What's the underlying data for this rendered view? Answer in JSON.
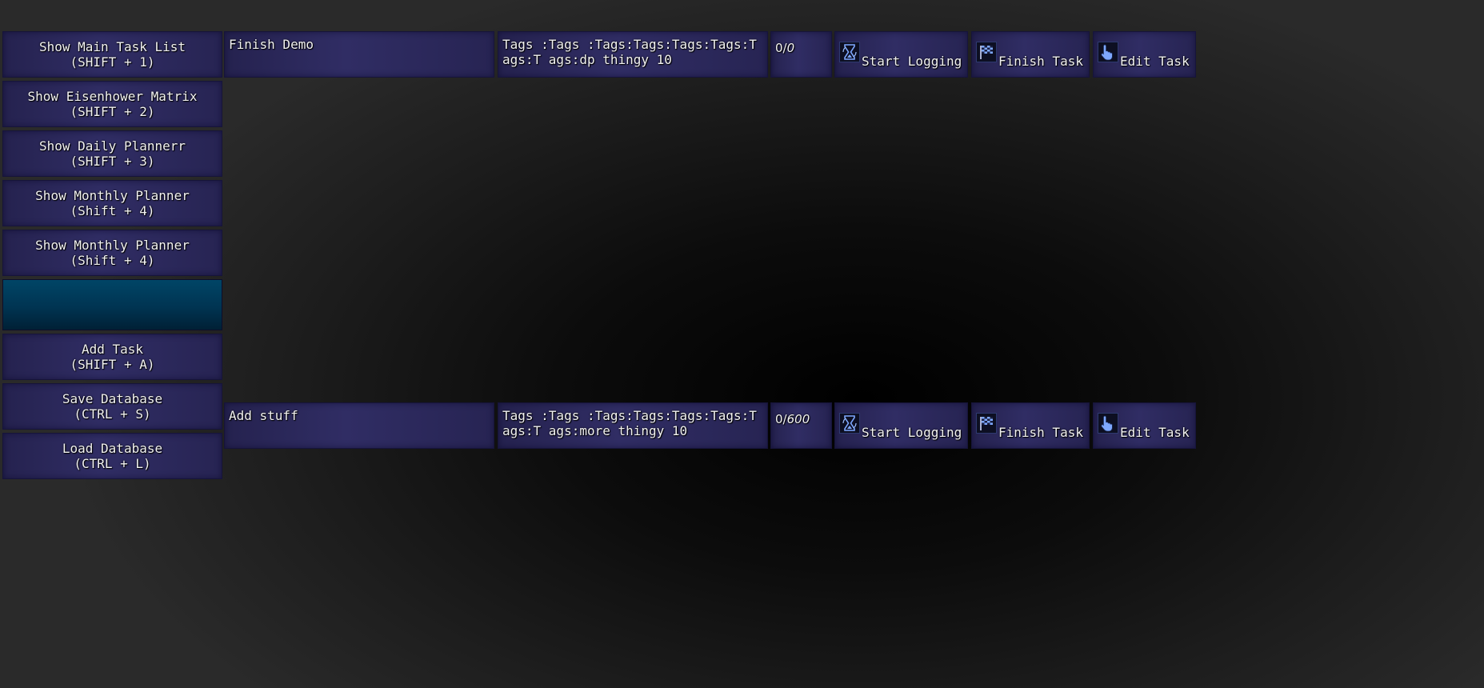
{
  "sidebar": {
    "items": [
      {
        "label": "Show Main Task List",
        "shortcut": "(SHIFT + 1)"
      },
      {
        "label": "Show Eisenhower Matrix",
        "shortcut": "(SHIFT + 2)"
      },
      {
        "label": "Show Daily Plannerr",
        "shortcut": "(SHIFT + 3)"
      },
      {
        "label": "Show Monthly Planner",
        "shortcut": "(Shift + 4)"
      },
      {
        "label": "Show Monthly Planner",
        "shortcut": "(Shift + 4)"
      },
      {
        "label": "Add Task",
        "shortcut": "(SHIFT + A)"
      },
      {
        "label": "Save Database",
        "shortcut": "(CTRL + S)"
      },
      {
        "label": "Load Database",
        "shortcut": "(CTRL + L)"
      }
    ]
  },
  "tasks": [
    {
      "name": "Finish Demo",
      "tags": "Tags :Tags :Tags:Tags:Tags:Tags:Tags:T ags:dp thingy 10",
      "time_logged": "0/",
      "time_total": "0",
      "start_logging_label": "Start Logging",
      "finish_task_label": "Finish Task",
      "edit_task_label": "Edit Task"
    },
    {
      "name": "Add stuff",
      "tags": "Tags :Tags :Tags:Tags:Tags:Tags:Tags:T ags:more thingy 10",
      "time_logged": "0/",
      "time_total": "600",
      "start_logging_label": "Start Logging",
      "finish_task_label": "Finish Task",
      "edit_task_label": "Edit Task"
    }
  ],
  "icons": {
    "start_logging": "hourglass-icon",
    "finish_task": "checkered-flag-icon",
    "edit_task": "pointing-hand-icon"
  },
  "colors": {
    "panel": "#2c2960",
    "panel_border": "#16143a",
    "spacer": "#004566",
    "icon_accent": "#7ea8ff",
    "text": "#f2f2f2"
  }
}
